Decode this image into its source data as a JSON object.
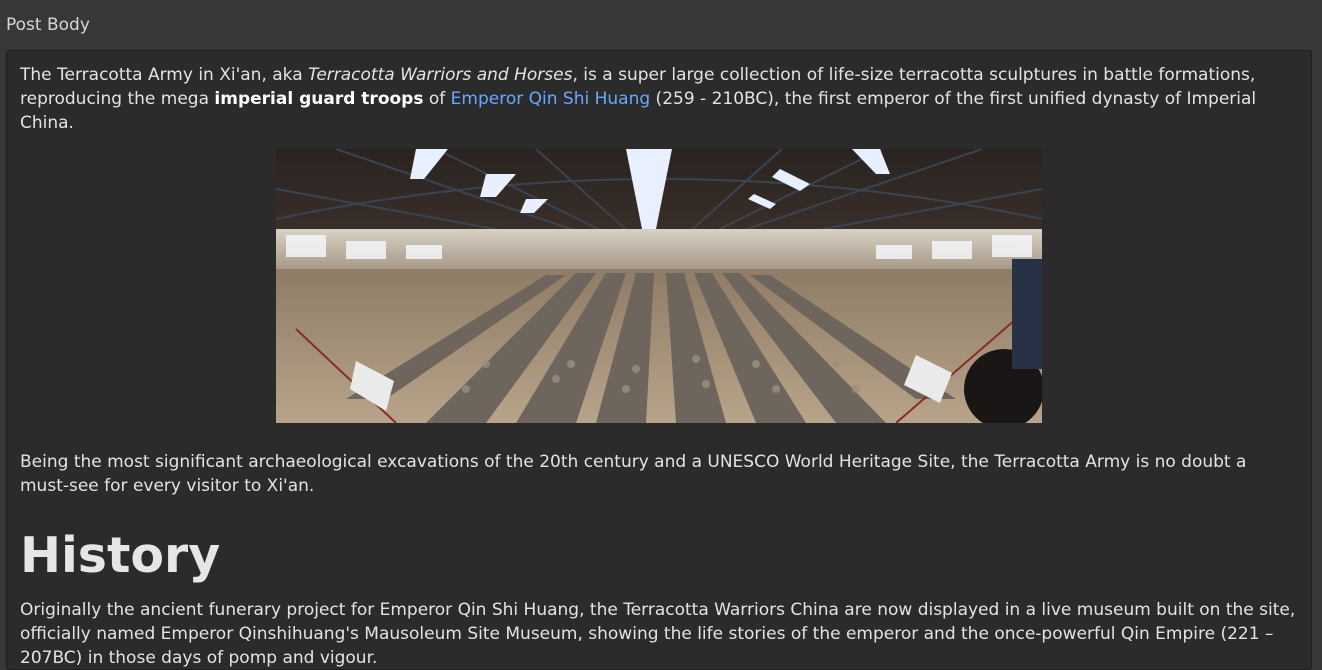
{
  "field": {
    "label": "Post Body"
  },
  "post": {
    "intro": {
      "t1": "The Terracotta Army in Xi'an, aka ",
      "em": "Terracotta Warriors and Horses",
      "t2": ", is a super large collection of life-size terracotta sculptures in battle formations, reproducing the mega ",
      "strong": "imperial guard troops",
      "t3": " of ",
      "link": "Emperor Qin Shi Huang",
      "t4": " (259 - 210BC), the first emperor of the first unified dynasty of Imperial China."
    },
    "para2": "Being the most significant archaeological excavations of the 20th century and a UNESCO World Heritage Site, the Terracotta Army is no doubt a must-see for every visitor to Xi'an.",
    "heading": "History",
    "para3": "Originally the ancient funerary project for Emperor Qin Shi Huang, the Terracotta Warriors China are now displayed in a live museum built on the site, officially named Emperor Qinshihuang's Mausoleum Site Museum, showing the life stories of the emperor and the once-powerful Qin Empire (221 – 207BC) in those days of pomp and vigour."
  },
  "colors": {
    "background": "#383838",
    "editor_background": "#2b2b2b",
    "link": "#6aa7ff",
    "text": "#e3e3e3"
  },
  "icons": {}
}
